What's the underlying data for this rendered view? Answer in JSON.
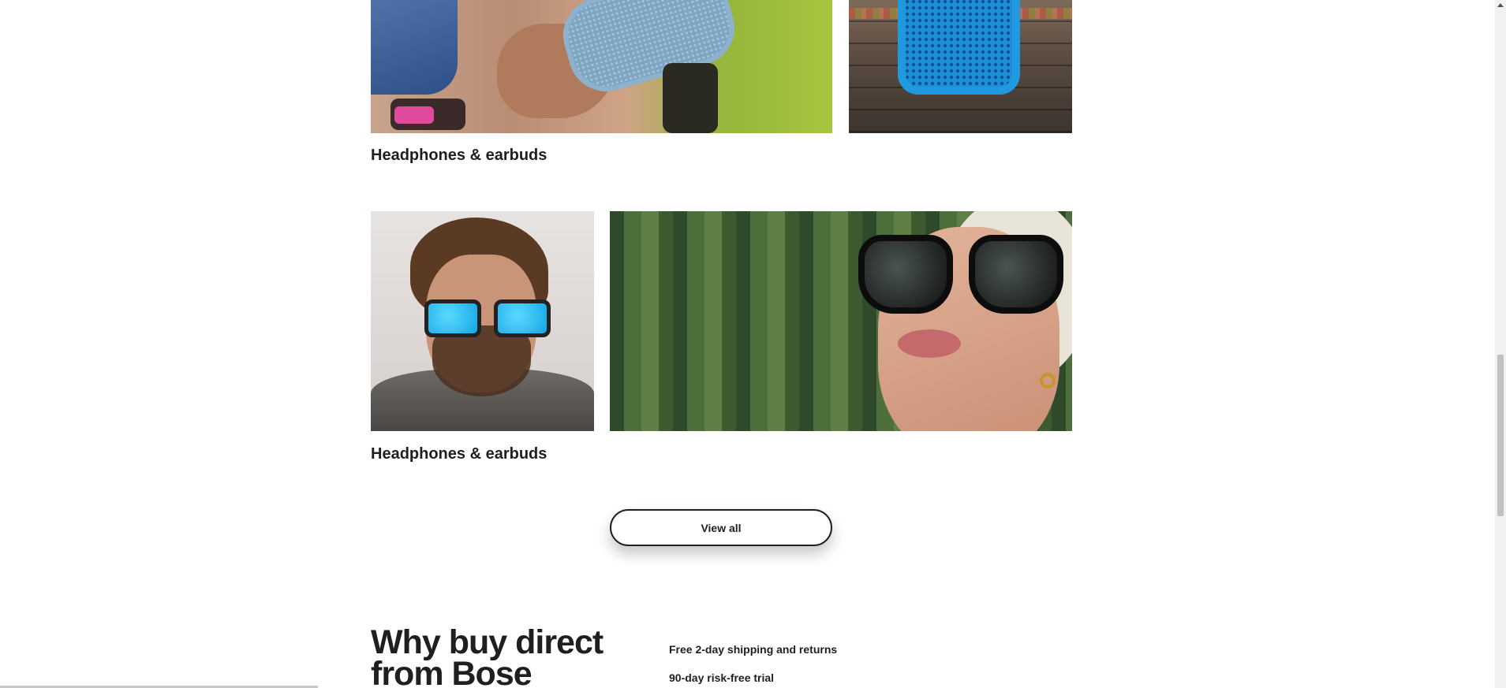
{
  "categories": [
    {
      "caption": "Headphones & earbuds"
    },
    {
      "caption": "Headphones & earbuds"
    }
  ],
  "view_all": {
    "label": "View all"
  },
  "why_direct": {
    "title": "Why buy direct from Bose",
    "benefits": [
      "Free 2-day shipping and returns",
      "90-day risk-free trial"
    ]
  },
  "images": {
    "speaker_hand": "portable-speaker-held-in-hands",
    "speaker_wood": "blue-speaker-on-wood",
    "man": "man-wearing-blue-sunglasses",
    "woman": "woman-wearing-black-sunglasses"
  },
  "colors": {
    "text": "#1f1f1f",
    "background": "#ffffff",
    "button_border": "#1f1f1f"
  }
}
